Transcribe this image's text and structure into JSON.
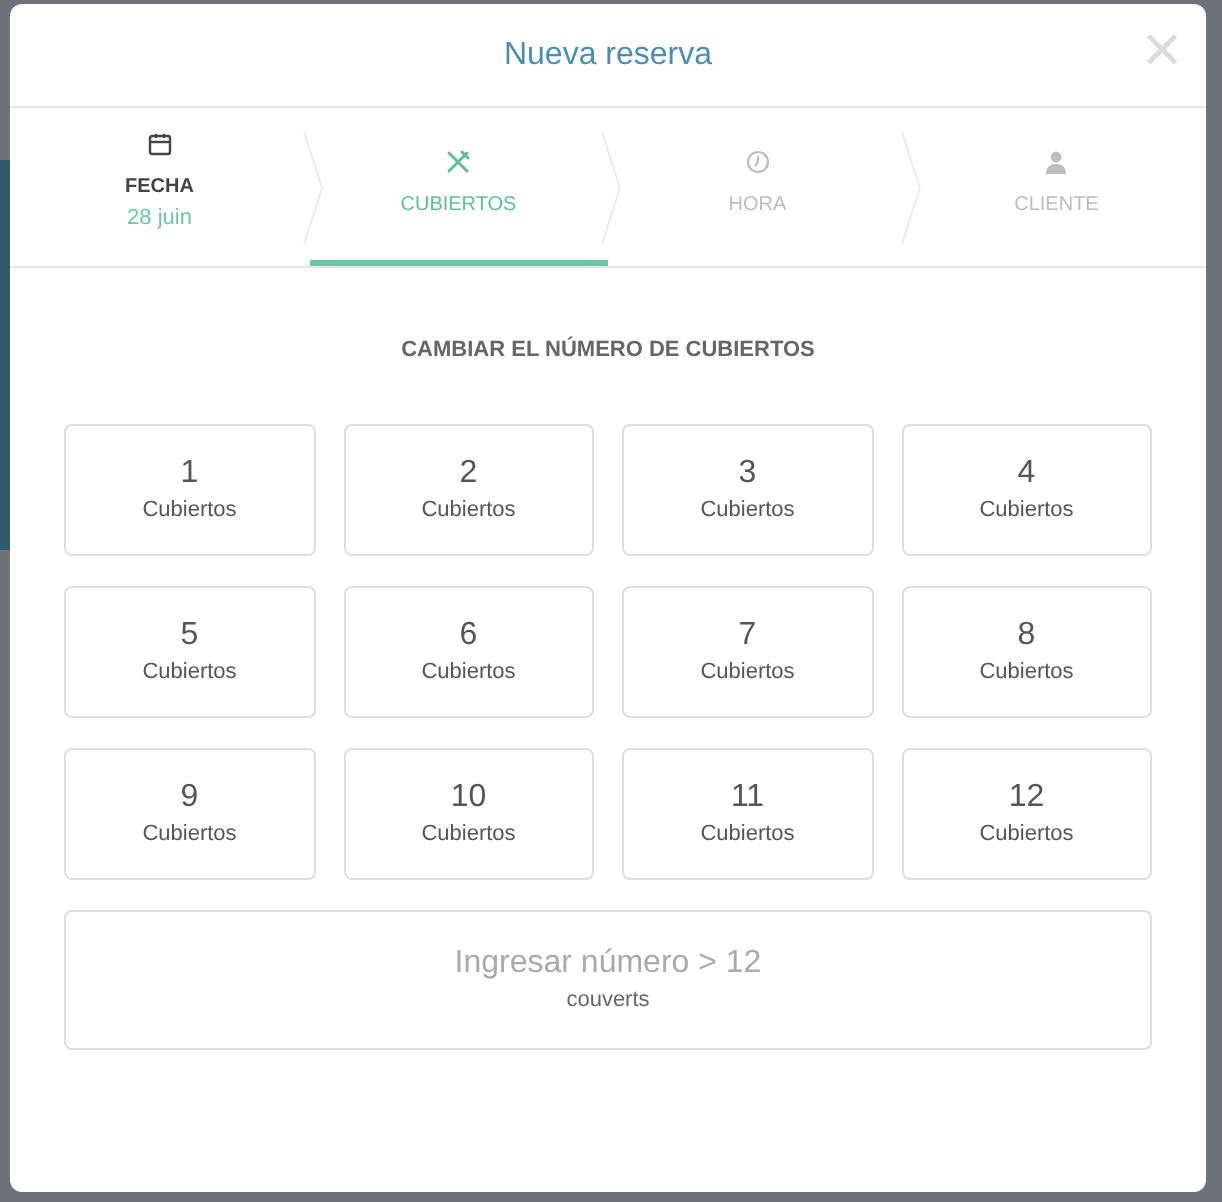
{
  "modal": {
    "title": "Nueva reserva",
    "close": "×"
  },
  "steps": [
    {
      "label": "FECHA",
      "value": "28 juin",
      "completed": true,
      "selected": false
    },
    {
      "label": "CUBIERTOS",
      "completed": false,
      "selected": true
    },
    {
      "label": "HORA",
      "completed": false,
      "selected": false
    },
    {
      "label": "CLIENTE",
      "completed": false,
      "selected": false
    }
  ],
  "heading": "CAMBIAR EL NÚMERO DE CUBIERTOS",
  "options": [
    {
      "number": "1",
      "unit": "Cubiertos"
    },
    {
      "number": "2",
      "unit": "Cubiertos"
    },
    {
      "number": "3",
      "unit": "Cubiertos"
    },
    {
      "number": "4",
      "unit": "Cubiertos"
    },
    {
      "number": "5",
      "unit": "Cubiertos"
    },
    {
      "number": "6",
      "unit": "Cubiertos"
    },
    {
      "number": "7",
      "unit": "Cubiertos"
    },
    {
      "number": "8",
      "unit": "Cubiertos"
    },
    {
      "number": "9",
      "unit": "Cubiertos"
    },
    {
      "number": "10",
      "unit": "Cubiertos"
    },
    {
      "number": "11",
      "unit": "Cubiertos"
    },
    {
      "number": "12",
      "unit": "Cubiertos"
    }
  ],
  "custom": {
    "label": "Ingresar número > 12",
    "unit": "couverts"
  }
}
